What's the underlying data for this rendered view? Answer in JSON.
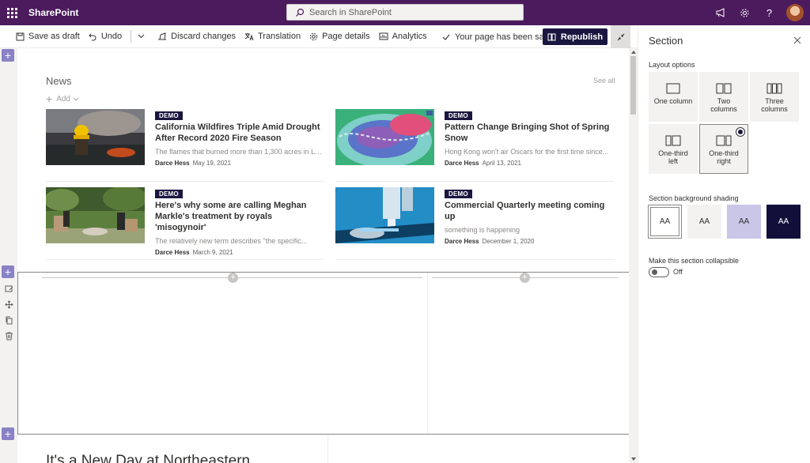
{
  "suite": {
    "app_name": "SharePoint",
    "search_placeholder": "Search in SharePoint"
  },
  "commands": {
    "save_draft": "Save as draft",
    "undo": "Undo",
    "discard": "Discard changes",
    "translation": "Translation",
    "page_details": "Page details",
    "analytics": "Analytics",
    "saved_status": "Your page has been saved",
    "republish": "Republish"
  },
  "news": {
    "title": "News",
    "see_all": "See all",
    "add": "Add",
    "cards": [
      {
        "tag": "DEMO",
        "title": "California Wildfires Triple Amid Drought After Record 2020 Fire Season",
        "description": "The flames that burned more than 1,300 acres in Lo...",
        "author": "Darce Hess",
        "date": "May 19, 2021"
      },
      {
        "tag": "DEMO",
        "title": "Pattern Change Bringing Shot of Spring Snow",
        "description": "Hong Kong won't air Oscars for the first time since...",
        "author": "Darce Hess",
        "date": "April 13, 2021"
      },
      {
        "tag": "DEMO",
        "title": "Here's why some are calling Meghan Markle's treatment by royals 'misogynoir'",
        "description": "The relatively new term describes \"the specific...",
        "author": "Darce Hess",
        "date": "March 9, 2021"
      },
      {
        "tag": "DEMO",
        "title": "Commercial Quarterly meeting coming up",
        "description": "something is happening",
        "author": "Darce Hess",
        "date": "December 1, 2020"
      }
    ]
  },
  "bottom_heading": "It's a New Day at Northeastern",
  "pane": {
    "title": "Section",
    "layout_label": "Layout options",
    "layouts": [
      {
        "line1": "One column",
        "line2": ""
      },
      {
        "line1": "Two",
        "line2": "columns"
      },
      {
        "line1": "Three",
        "line2": "columns"
      },
      {
        "line1": "One-third",
        "line2": "left"
      },
      {
        "line1": "One-third",
        "line2": "right"
      }
    ],
    "selected_layout": "One-third right",
    "shading_label": "Section background shading",
    "shading_options": [
      {
        "text": "AA",
        "bg": "#ffffff",
        "fg": "#323130"
      },
      {
        "text": "AA",
        "bg": "#f3f2f1",
        "fg": "#323130"
      },
      {
        "text": "AA",
        "bg": "#c9c6e8",
        "fg": "#323130"
      },
      {
        "text": "AA",
        "bg": "#12103a",
        "fg": "#ffffff"
      }
    ],
    "collapsible_label": "Make this section collapsible",
    "toggle_state": "Off"
  },
  "colors": {
    "suite_bar": "#4b1b5d",
    "accent": "#1b1640",
    "rail_plus": "#8a82c6"
  }
}
